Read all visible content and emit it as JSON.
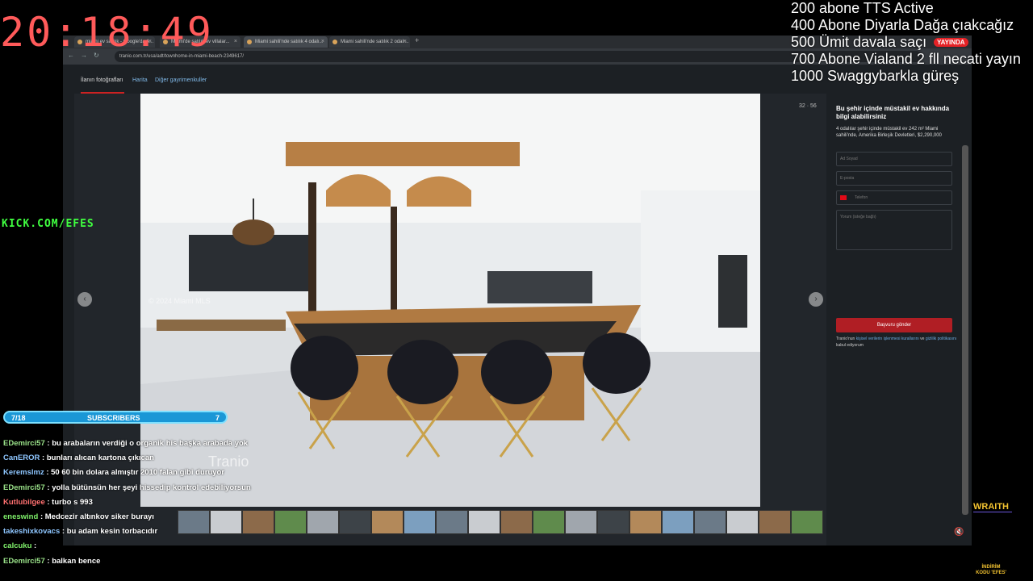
{
  "clock": "20:18:49",
  "kick_url": "KICK.COM/EFES",
  "goals": [
    "200 abone TTS Active",
    "400 Abone Diyarla Dağa çıakcağız",
    "500 Ümit davala saçı",
    "700 Abone Vialand 2 fll necati yayın",
    "1000 Swaggybarkla güreş"
  ],
  "live_badge": "YAYINDA",
  "browser": {
    "tabs": [
      {
        "title": "miami ev satılık - Google'da A..."
      },
      {
        "title": "Miami'de satılık ev villalar..."
      },
      {
        "title": "Miami sahili'nde satılık 4 odalı..."
      },
      {
        "title": "Miami sahili'nde satılık 2 odalı..."
      }
    ],
    "url": "tranio.com.tr/usa/adt/townhome-in-miami-beach-2349617/"
  },
  "listing": {
    "subnav": [
      "İlanın fotoğrafları",
      "Harita",
      "Diğer gayrimenkuller"
    ],
    "counter": "32 · 56",
    "photo_caption": "© 2024 Miami MLS",
    "watermark": "Tranio"
  },
  "form": {
    "title": "Bu şehir içinde müstakil ev hakkında bilgi alabilirsiniz",
    "description": "4 odalılar şehir içinde müstakil ev 242 m² Miami sahili'nde, Amerika Birleşik Devletleri, $2,290,000",
    "name_placeholder": "Ad Soyad",
    "email_placeholder": "E-posta",
    "phone_placeholder": "Telefon",
    "message_placeholder": "Yorum (isteğe bağlı)",
    "submit_label": "Başvuru gönder",
    "consent_prefix": "Tranio'nun",
    "consent_link1": "kişisel verilerin işlenmesi kurallarını",
    "consent_mid": "ve",
    "consent_link2": "gizlilik politikasını",
    "consent_suffix": "kabul ediyorum"
  },
  "subscribers": {
    "left": "7/18",
    "label": "SUBSCRIBERS",
    "right": "7"
  },
  "chat": [
    {
      "user": "EDemirci57",
      "msg": ": bu arabaların verdiği o organik his başka arabada yok",
      "color": "green"
    },
    {
      "user": "CanEROR",
      "msg": ": bunları alıcan kartona çıkıcan",
      "color": "blue"
    },
    {
      "user": "Keremslmz",
      "msg": ": 50 60 bin dolara almıştır 2010 falan gibi duruyor",
      "color": "blue"
    },
    {
      "user": "EDemirci57",
      "msg": ": yolla bütünsün her şeyi hissedip kontrol edebiliyorsun",
      "color": "green"
    },
    {
      "user": "Kutlubilgee",
      "msg": ": turbo s 993",
      "color": "red"
    },
    {
      "user": "eneswind",
      "msg": ": Medcezir altınkov siker burayı",
      "color": "green2"
    },
    {
      "user": "takeshixkovacs",
      "msg": ": bu adam kesin torbacıdır",
      "color": "blue"
    },
    {
      "user": "calcuku",
      "msg": ":",
      "color": "green2"
    },
    {
      "user": "EDemirci57",
      "msg": ": balkan bence",
      "color": "green"
    }
  ],
  "sponsor": {
    "name": "WRAITH",
    "code": "İNDİRİM KODU 'EFES'"
  }
}
